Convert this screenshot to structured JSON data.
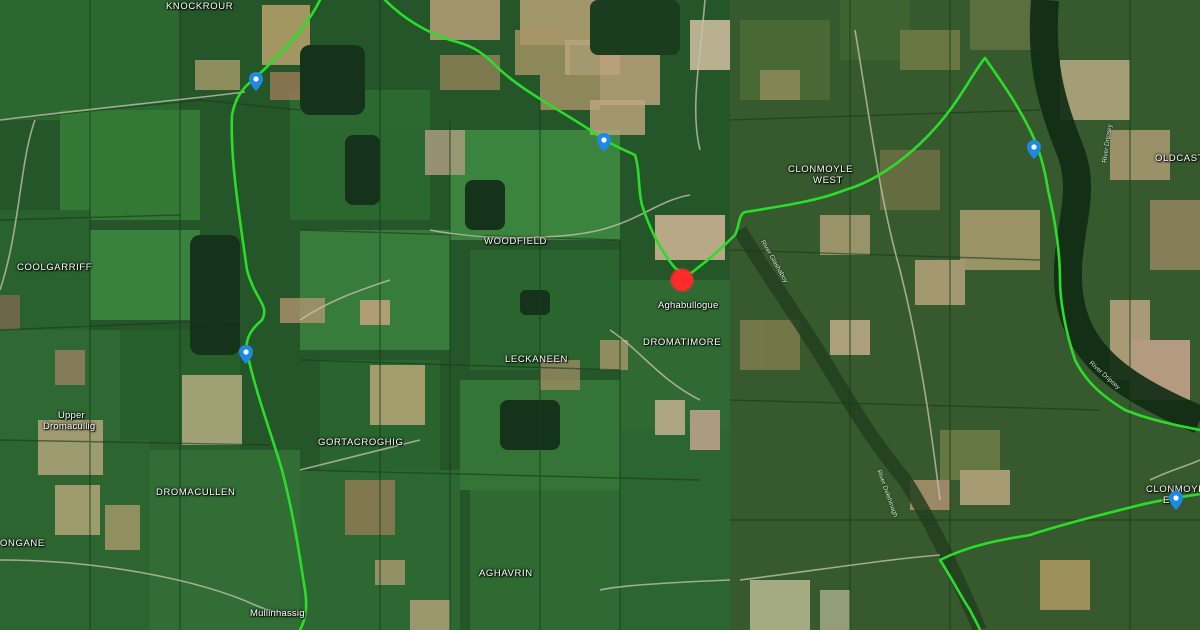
{
  "map": {
    "basemap": "satellite",
    "colors": {
      "route": "#2bdc2b",
      "pin": "#1e88e5",
      "marker": "#ff2a2a"
    },
    "townlands": {
      "knockrour": "KNOCKROUR",
      "woodfield": "WOODFIELD",
      "coolgarriff": "COOLGARRIFF",
      "clonmoyle_west_1": "CLONMOYLE",
      "clonmoyle_west_2": "WEST",
      "oldcastle": "OLDCAST",
      "leckaneen": "LECKANEEN",
      "dromatimore": "DROMATIMORE",
      "upper_dromacullig_1": "Upper",
      "upper_dromacullig_2": "Dromacullig",
      "gortacroghig": "GORTACROGHIG",
      "dromacullen": "DROMACULLEN",
      "ongane": "ONGANE",
      "aghavrin": "AGHAVRIN",
      "clonmoyle_east": "CLONMOYLE",
      "clonmoyle_east_2": "E"
    },
    "places": {
      "aghabullogue": "Aghabullogue",
      "mullinhassig": "Mullinhassig"
    },
    "rivers": {
      "dripsey": "River Dripsey",
      "glashaboy": "River Glashaboy",
      "delehinagh": "River Delehinagh",
      "dripsey_2": "River Dripsey"
    },
    "pins": [
      {
        "name": "pin-knockrour"
      },
      {
        "name": "pin-north"
      },
      {
        "name": "pin-east"
      },
      {
        "name": "pin-coolgarriff"
      },
      {
        "name": "pin-clonmoyle-east"
      }
    ],
    "marker_icon": "location-marker-icon",
    "pin_icon": "map-pin-icon"
  }
}
